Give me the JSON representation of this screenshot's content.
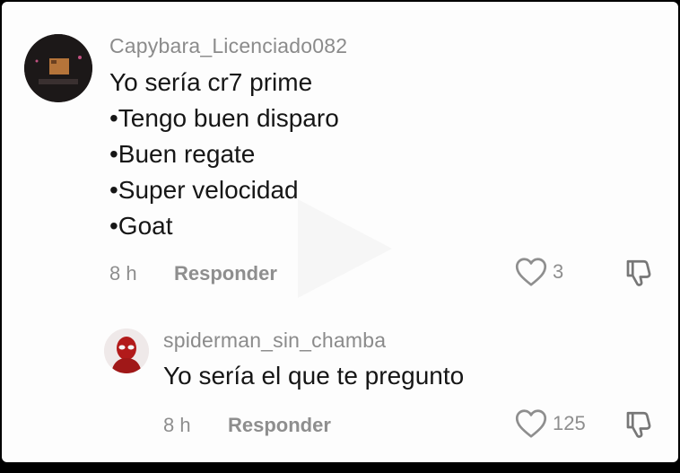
{
  "comments": [
    {
      "username": "Capybara_Licenciado082",
      "lines": [
        "Yo sería cr7 prime",
        "•Tengo buen disparo",
        "•Buen regate",
        "•Super velocidad",
        "•Goat"
      ],
      "time": "8 h",
      "reply_label": "Responder",
      "likes": "3"
    },
    {
      "username": "spiderman_sin_chamba",
      "lines": [
        "Yo sería el que te pregunto"
      ],
      "time": "8 h",
      "reply_label": "Responder",
      "likes": "125"
    }
  ],
  "icons": {
    "like": "heart-outline-icon",
    "dislike": "thumbs-down-icon",
    "overlay": "play-icon"
  },
  "colors": {
    "background": "#fdfdfd",
    "text": "#161616",
    "muted": "#8e8e8e"
  }
}
